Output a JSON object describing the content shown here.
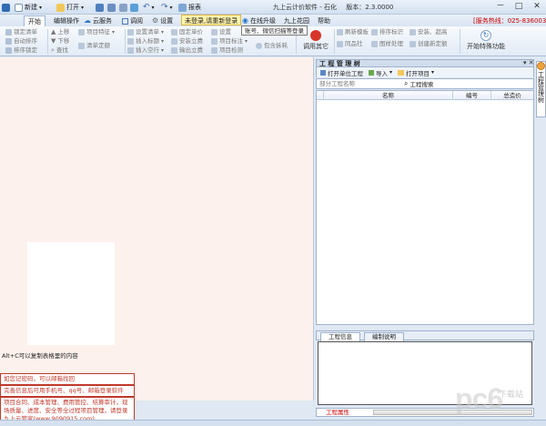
{
  "app": {
    "title": "九上云计价软件 - 石化",
    "version_label": "版本：2.3.0000"
  },
  "quick_access": {
    "new_label": "新建",
    "open_label": "打开",
    "report_label": "报表"
  },
  "window_controls": {
    "minimize": "－",
    "maximize": "□",
    "close": "✕"
  },
  "menu": {
    "items": [
      {
        "label": "开始"
      },
      {
        "label": "编辑操作"
      },
      {
        "label": "云服务"
      },
      {
        "label": "调阅"
      },
      {
        "label": "设置"
      },
      {
        "label": "在线升级"
      },
      {
        "label": "九上花园"
      },
      {
        "label": "帮助"
      }
    ],
    "login_badge": "未登录,请重新登录",
    "login_tip": "账号、微信扫描等登录",
    "hotline": "[服务热线：025-83600346]"
  },
  "ribbon": {
    "col1": [
      "锁定清单",
      "自动排序",
      "排序锁定"
    ],
    "col2": [
      "上移",
      "下移",
      "查找"
    ],
    "col3": [
      "项目特征",
      "清单定额"
    ],
    "col4": [
      "设置清单",
      "插入标题",
      "插入空行"
    ],
    "col5": [
      "固定单价",
      "安装立费",
      "输出立费"
    ],
    "col6": [
      "设置",
      "项目标注",
      "项目检测"
    ],
    "col7": [
      "包含拆耗"
    ],
    "col8": [
      "调用其它"
    ],
    "col9": [
      "刷新模板",
      "同品社"
    ],
    "col10": [
      "排序标识",
      "图样处理"
    ],
    "col11": [
      "安装、超高",
      "创建新定额"
    ],
    "big_button": "开始特殊功能"
  },
  "left_pane": {
    "copy_hint": "Alt+C可以复制表格里的内容",
    "messages": [
      "如您记密码，可以邮箱找回",
      "完善信息后可用手机号、qq号、邮箱登录软件",
      "项目合同、成本管理、费用管控、结算审计，现场质量、进度、安全等全过程项目管理，请登录九上云管家(www.9090915.com)"
    ]
  },
  "right_panel": {
    "title": "工 程 管 理 树",
    "pin": "▾ ✕",
    "toolbar": {
      "open_unit": "打开单位工程",
      "import": "导入",
      "open_project": "打开项目"
    },
    "search": {
      "placeholder": "部分工程名称",
      "button": "工程搜索"
    },
    "columns": [
      "名称",
      "编号",
      "总造价"
    ],
    "tabs": [
      "工程信息",
      "编制说明"
    ],
    "property_label": "工程属性"
  },
  "side_tab": {
    "label": "工程管理树"
  },
  "watermark": {
    "main": "pc6",
    "sub": "下载站"
  },
  "colors": {
    "accent_red": "#c0392b",
    "left_bg": "#fcf1ec",
    "ribbon_bg": "#e2ebf6"
  }
}
